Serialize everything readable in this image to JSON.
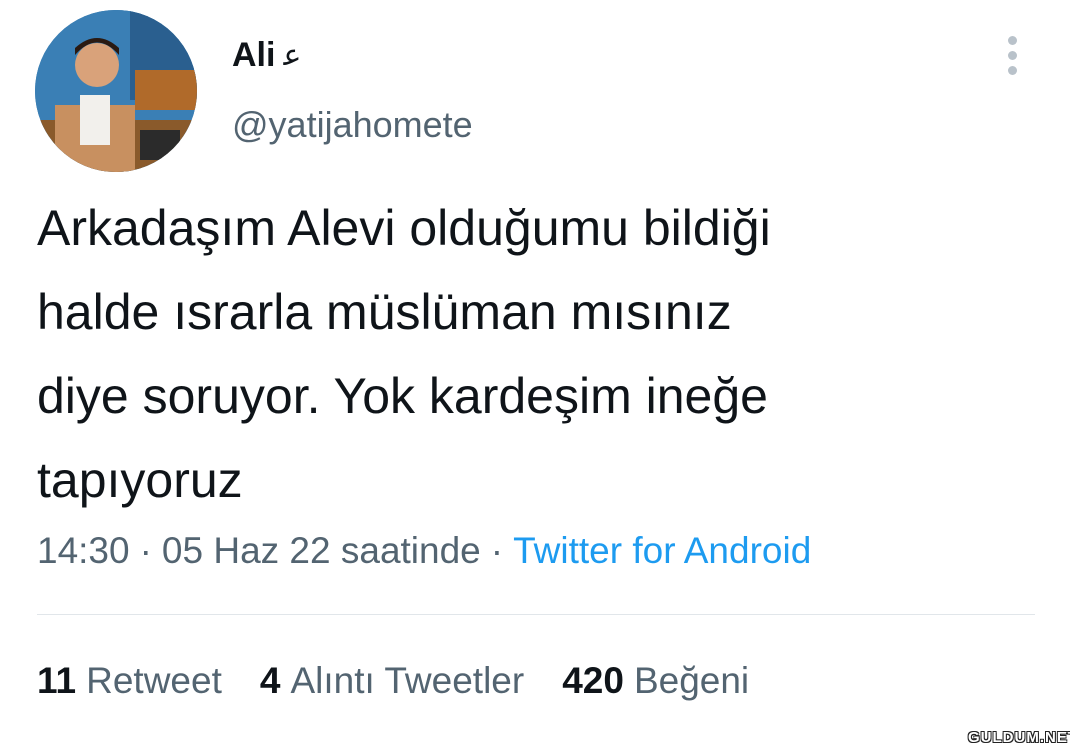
{
  "user": {
    "display_name": "Ali",
    "name_glyph": "ﻋ",
    "handle": "@yatijahomete"
  },
  "tweet": {
    "text": "Arkadaşım Alevi olduğumu bildiği\nhalde ısrarla müslüman mısınız\ndiye soruyor. Yok kardeşim ineğe\ntapıyoruz",
    "time": "14:30",
    "date": "05 Haz 22 saatinde",
    "separator": "·",
    "source": "Twitter for Android"
  },
  "stats": {
    "retweets": {
      "count": "11",
      "label": "Retweet"
    },
    "quotes": {
      "count": "4",
      "label": "Alıntı Tweetler"
    },
    "likes": {
      "count": "420",
      "label": "Beğeni"
    }
  },
  "watermark": "GULDUM.NET",
  "colors": {
    "text": "#0f1419",
    "secondary": "#536471",
    "link": "#1d9bf0",
    "divider": "#e1e6ea"
  },
  "icons": {
    "more": "more-vertical-icon"
  }
}
